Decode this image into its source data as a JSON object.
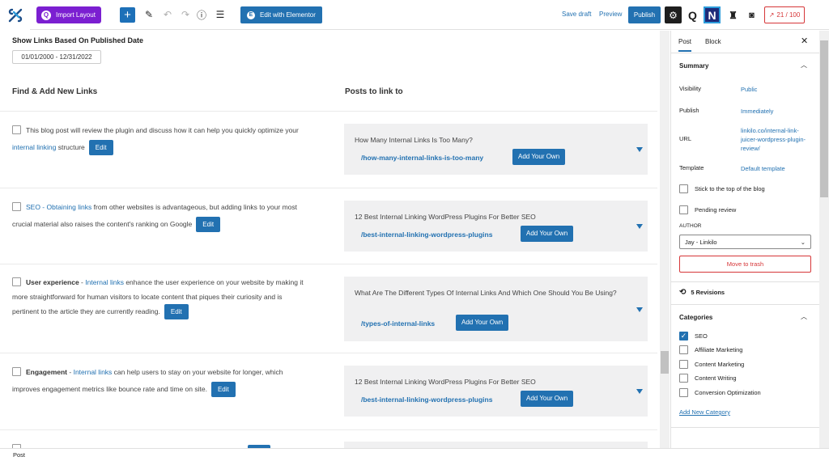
{
  "toolbar": {
    "import_label": "Import Layout",
    "elementor_label": "Edit with Elementor",
    "save_draft": "Save draft",
    "preview": "Preview",
    "publish": "Publish",
    "score": "21 / 100"
  },
  "main": {
    "date_title": "Show Links Based On Published Date",
    "date_range": "01/01/2000 - 12/31/2022",
    "left_heading": "Find & Add New Links",
    "right_heading": "Posts to link to",
    "edit_label": "Edit",
    "add_own_label": "Add Your Own",
    "rows": [
      {
        "lead_bold": "",
        "lead_link": "",
        "text_1": "This blog post will review the plugin and discuss how it can help you quickly optimize your ",
        "link": "internal linking",
        "text_2": " structure",
        "post_title": "How Many Internal Links Is Too Many?",
        "post_slug": "/how-many-internal-links-is-too-many"
      },
      {
        "lead_bold": "",
        "lead_link": "SEO - Obtaining links",
        "text_1": " from other websites is advantageous, but adding links to your most crucial material also raises the content's ranking on Google",
        "link": "",
        "text_2": "",
        "post_title": "12 Best Internal Linking WordPress Plugins For Better SEO",
        "post_slug": "/best-internal-linking-wordpress-plugins"
      },
      {
        "lead_bold": "User experience",
        "lead_sep": " - ",
        "lead_link": "Internal links",
        "text_1": " enhance the user experience on your website by making it more straightforward for human visitors to locate content that piques their curiosity and is pertinent to the article they are currently reading.",
        "link": "",
        "text_2": "",
        "post_title": "What Are The Different Types Of Internal Links And Which One Should You Be Using?",
        "post_slug": "/types-of-internal-links"
      },
      {
        "lead_bold": "Engagement",
        "lead_sep": " - ",
        "lead_link": "Internal links",
        "text_1": " can help users to stay on your website for longer, which improves engagement metrics like bounce rate and time on site.",
        "link": "",
        "text_2": "",
        "post_title": "12 Best Internal Linking WordPress Plugins For Better SEO",
        "post_slug": "/best-internal-linking-wordpress-plugins"
      }
    ]
  },
  "sidebar": {
    "tab_post": "Post",
    "tab_block": "Block",
    "summary_title": "Summary",
    "visibility_label": "Visibility",
    "visibility_value": "Public",
    "publish_label": "Publish",
    "publish_value": "Immediately",
    "url_label": "URL",
    "url_value": "linkilo.co/internal-link-juicer-wordpress-plugin-review/",
    "template_label": "Template",
    "template_value": "Default template",
    "sticky_label": "Stick to the top of the blog",
    "pending_label": "Pending review",
    "author_label": "AUTHOR",
    "author_value": "Jay - Linkilo",
    "trash_label": "Move to trash",
    "revisions_label": "5 Revisions",
    "categories_title": "Categories",
    "categories": [
      {
        "label": "SEO",
        "checked": true
      },
      {
        "label": "Affiliate Marketing",
        "checked": false
      },
      {
        "label": "Content Marketing",
        "checked": false
      },
      {
        "label": "Content Writing",
        "checked": false
      },
      {
        "label": "Conversion Optimization",
        "checked": false
      }
    ],
    "add_category": "Add New Category"
  },
  "status": {
    "label": "Post"
  },
  "colors": {
    "accent": "#2271b1",
    "import": "#7b1fd1",
    "danger": "#d63638"
  }
}
